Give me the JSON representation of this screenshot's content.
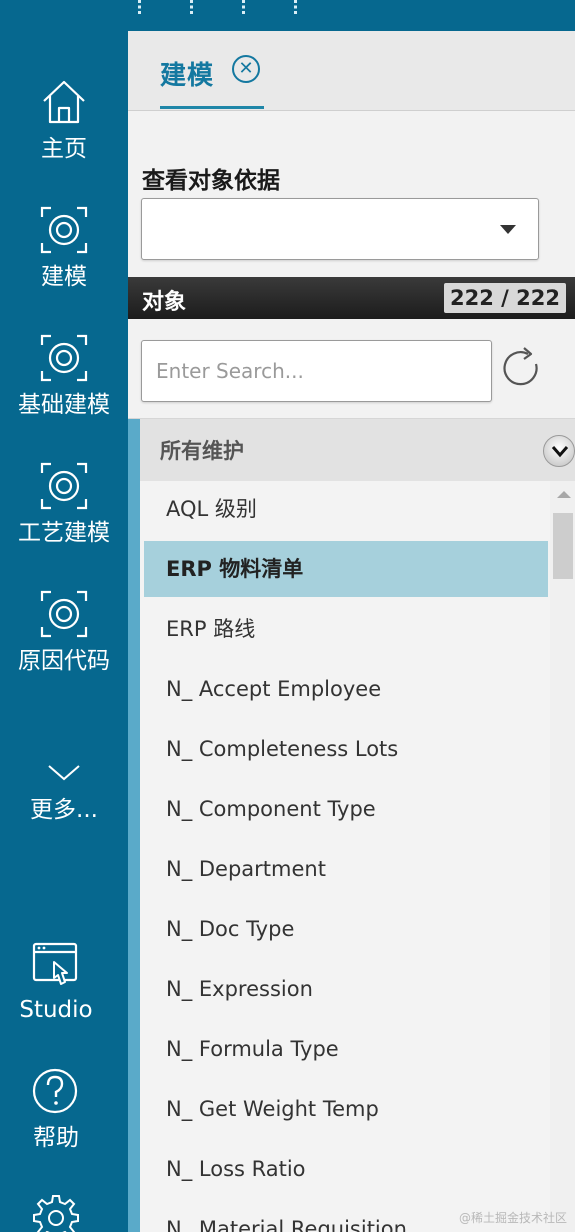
{
  "colors": {
    "rail": "#06688f",
    "accent": "#1478a0",
    "selected_row": "#a6d0dc",
    "objects_bar": "#2a2a2a"
  },
  "nav": {
    "home": {
      "label": "主页",
      "icon": "home-icon"
    },
    "modeling": {
      "label": "建模",
      "icon": "target-icon"
    },
    "base_modeling": {
      "label": "基础建模",
      "icon": "target-icon"
    },
    "process_modeling": {
      "label": "工艺建模",
      "icon": "target-icon"
    },
    "cause_code": {
      "label": "原因代码",
      "icon": "target-icon"
    },
    "more": {
      "label": "更多...",
      "icon": "chevron-down-icon"
    },
    "studio": {
      "label": "Studio",
      "icon": "studio-pointer-icon"
    },
    "help": {
      "label": "帮助",
      "icon": "question-icon"
    },
    "settings": {
      "icon": "gear-icon"
    }
  },
  "tab": {
    "label": "建模",
    "close_icon": "close-circle-icon"
  },
  "view_by": {
    "label": "查看对象依据",
    "selected": ""
  },
  "objects": {
    "title": "对象",
    "count": "222 / 222"
  },
  "search": {
    "placeholder": "Enter Search...",
    "value": ""
  },
  "group": {
    "label": "所有维护",
    "toggle_icon": "chevron-down-circle-icon"
  },
  "items": [
    "AQL 级别",
    "ERP 物料清单",
    "ERP 路线",
    "N_ Accept Employee",
    "N_ Completeness Lots",
    "N_ Component Type",
    "N_ Department",
    "N_ Doc Type",
    "N_ Expression",
    "N_ Formula Type",
    "N_ Get Weight Temp",
    "N_ Loss Ratio",
    "N_ Material Requisition"
  ],
  "selected_index": 1,
  "watermark": "@稀土掘金技术社区"
}
